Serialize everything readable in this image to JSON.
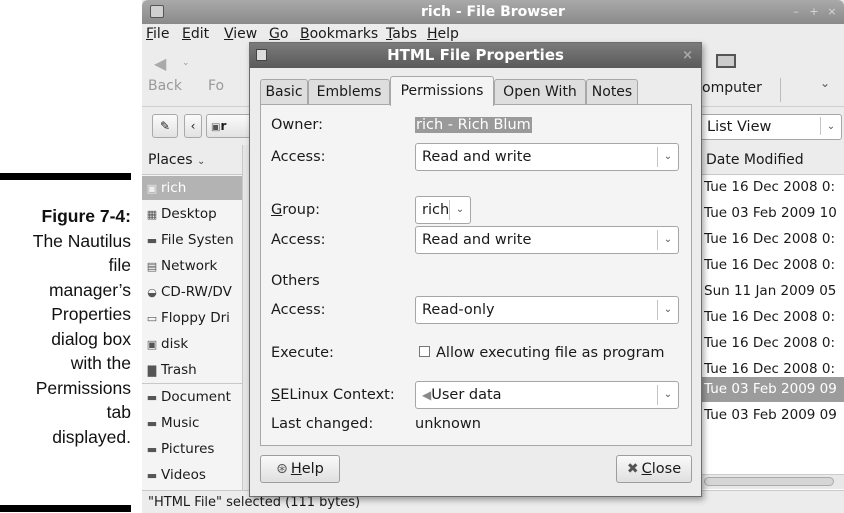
{
  "caption": {
    "figure": "Figure 7-4:",
    "lines": [
      "The Nautilus",
      "file",
      "manager’s",
      "Properties",
      "dialog box",
      "with the",
      "Permissions",
      "tab",
      "displayed."
    ]
  },
  "window": {
    "title": "rich - File Browser",
    "menu": [
      "File",
      "Edit",
      "View",
      "Go",
      "Bookmarks",
      "Tabs",
      "Help"
    ],
    "toolbar": {
      "back": "Back",
      "forward": "Fo",
      "computer": "omputer"
    },
    "view_mode": "List View",
    "location_button": "r",
    "sidebar": {
      "header": "Places",
      "items": [
        "rich",
        "Desktop",
        "File Systen",
        "Network",
        "CD-RW/DV",
        "Floppy Dri",
        "disk",
        "Trash",
        "Document",
        "Music",
        "Pictures",
        "Videos"
      ],
      "icons": [
        "home-folder-icon",
        "desktop-icon",
        "drive-icon",
        "network-icon",
        "cdrom-icon",
        "floppy-icon",
        "disk-icon",
        "trash-icon",
        "folder-icon",
        "folder-icon",
        "folder-icon",
        "folder-icon"
      ]
    },
    "column_header": "Date Modified",
    "dates": [
      "Tue 16 Dec 2008 0:",
      "Tue 03 Feb 2009 10",
      "Tue 16 Dec 2008 0:",
      "Tue 16 Dec 2008 0:",
      "Sun 11 Jan 2009 05",
      "Tue 16 Dec 2008 0:",
      "Tue 16 Dec 2008 0:",
      "Tue 16 Dec 2008 0:",
      "Tue 03 Feb 2009 09",
      "Tue 03 Feb 2009 09"
    ],
    "selected_date_index": 8,
    "status": "\"HTML File\" selected (111 bytes)"
  },
  "dialog": {
    "title": "HTML File Properties",
    "tabs": [
      "Basic",
      "Emblems",
      "Permissions",
      "Open With",
      "Notes"
    ],
    "active_tab": "Permissions",
    "owner_label": "Owner:",
    "owner_value": "rich - Rich Blum",
    "access_label": "Access:",
    "owner_access": "Read and write",
    "group_label": "Group:",
    "group_value": "rich",
    "group_access": "Read and write",
    "others_label": "Others",
    "others_access": "Read-only",
    "execute_label": "Execute:",
    "execute_option": "Allow executing file as program",
    "execute_checked": false,
    "selinux_label": "SELinux Context:",
    "selinux_value": "User data",
    "last_changed_label": "Last changed:",
    "last_changed_value": "unknown",
    "help_button": "Help",
    "close_button": "Close"
  }
}
